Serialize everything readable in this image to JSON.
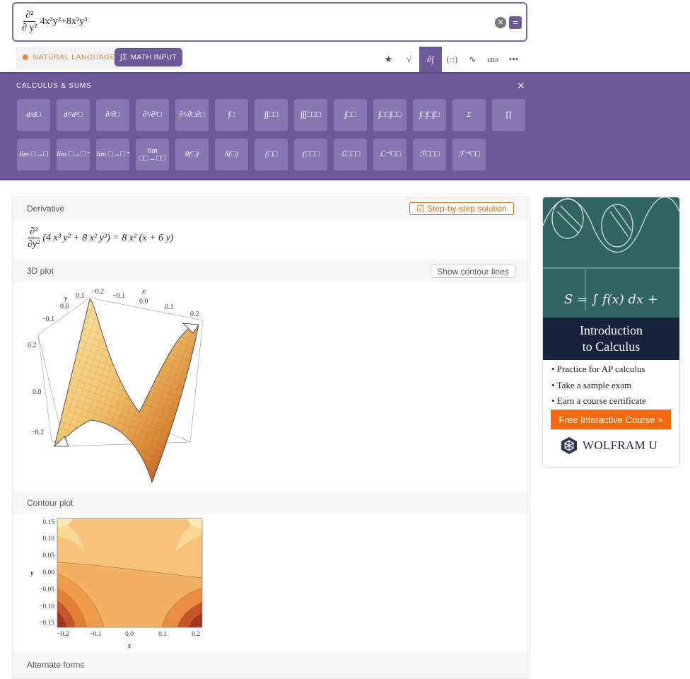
{
  "input": {
    "numerator": "∂²",
    "denominator": "∂ y²",
    "expression": "4x³y²+8x²y³"
  },
  "modes": {
    "natural_language": "NATURAL LANGUAGE",
    "math_input": "MATH INPUT"
  },
  "toolbar": [
    "★",
    "√",
    "∂∫",
    "(::)",
    "∿",
    "αω",
    "•••"
  ],
  "palette": {
    "title": "CALCULUS & SUMS",
    "row1": [
      "d/d□",
      "d²/d²□",
      "∂/∂□",
      "∂²/∂²□",
      "∂²/∂□∂□",
      "∫□",
      "∫∫□□",
      "∫∫∫□□□",
      "∫□□",
      "∫□□∫□□",
      "∫□∫□∫□",
      "Σ",
      "∏"
    ],
    "row2": [
      "lim □→□",
      "lim □→□⁻",
      "lim □→□⁺",
      "lim □□→□□",
      "θ(□)",
      "δ(□)",
      "{□□",
      "{□□□",
      "ℒ□□□",
      "ℒ⁻¹□□",
      "ℱ□□□",
      "ℱ⁻¹□□"
    ]
  },
  "pods": {
    "derivative": {
      "title": "Derivative",
      "step_button": "Step-by-step solution",
      "lhs_num": "∂²",
      "lhs_den": "∂y²",
      "body": "(4 x³ y² + 8 x² y³) = 8 x² (x + 6 y)"
    },
    "plot3d": {
      "title": "3D plot",
      "contour_button": "Show contour lines",
      "xlabel": "x",
      "ylabel": "y",
      "x_ticks": [
        "−0.2",
        "−0.1",
        "0.0",
        "0.1",
        "0.2"
      ],
      "y_ticks": [
        "0.1",
        "0.0",
        "−0.1"
      ],
      "z_ticks": [
        "0.2",
        "0.0",
        "−0.2"
      ]
    },
    "contour": {
      "title": "Contour plot",
      "x_ticks": [
        "−0.2",
        "−0.1",
        "0.0",
        "0.1",
        "0.2"
      ],
      "y_ticks": [
        "0.15",
        "0.10",
        "0.05",
        "0.00",
        "−0.05",
        "−0.10",
        "−0.15"
      ],
      "xlabel": "x",
      "ylabel": "y"
    },
    "alternate": {
      "title": "Alternate forms"
    }
  },
  "ad": {
    "heading1": "Introduction",
    "heading2": "to Calculus",
    "bullets": [
      "• Practice for AP calculus",
      "• Take a sample exam",
      "• Earn a course certificate"
    ],
    "cta": "Free Interactive Course »",
    "brand": "WOLFRAM U",
    "chalk_text": "S = ∫ f(x) dx +"
  },
  "colors": {
    "accent": "#6b5a97",
    "orange": "#e0691b",
    "cta": "#f36a13"
  }
}
